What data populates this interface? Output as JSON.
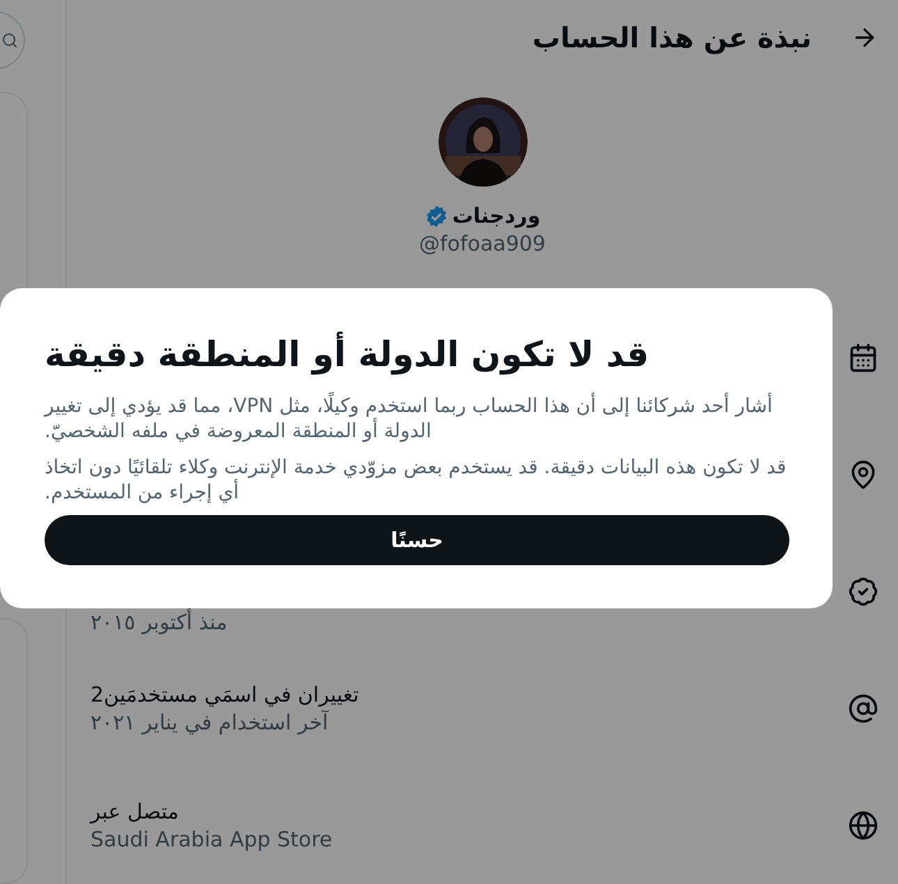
{
  "header": {
    "title": "نبذة عن هذا الحساب"
  },
  "profile": {
    "name": "وردجنات",
    "verified": true,
    "handle": "@fofoaa909"
  },
  "rows": [
    {
      "kind": "calendar"
    },
    {
      "kind": "location"
    },
    {
      "kind": "verified",
      "detail": "منذ أكتوبر ٢٠١٥"
    },
    {
      "kind": "username",
      "title": "تغييران في اسمَي مستخدمَين2",
      "detail": "آخر استخدام في يناير ٢٠٢١"
    },
    {
      "kind": "globe",
      "title": "متصل عبر",
      "detail": "Saudi Arabia App Store"
    }
  ],
  "dialog": {
    "title": "قد لا تكون الدولة أو المنطقة دقيقة",
    "paragraphs": [
      "أشار أحد شركائنا إلى أن هذا الحساب ربما استخدم وكيلًا، مثل VPN، مما قد يؤدي إلى تغيير الدولة أو المنطقة المعروضة في ملفه الشخصيّ.",
      "قد لا تكون هذه البيانات دقيقة. قد يستخدم بعض مزوّدي خدمة الإنترنت وكلاء تلقائيًا دون اتخاذ أي إجراء من المستخدم."
    ],
    "button": "حسنًا"
  }
}
